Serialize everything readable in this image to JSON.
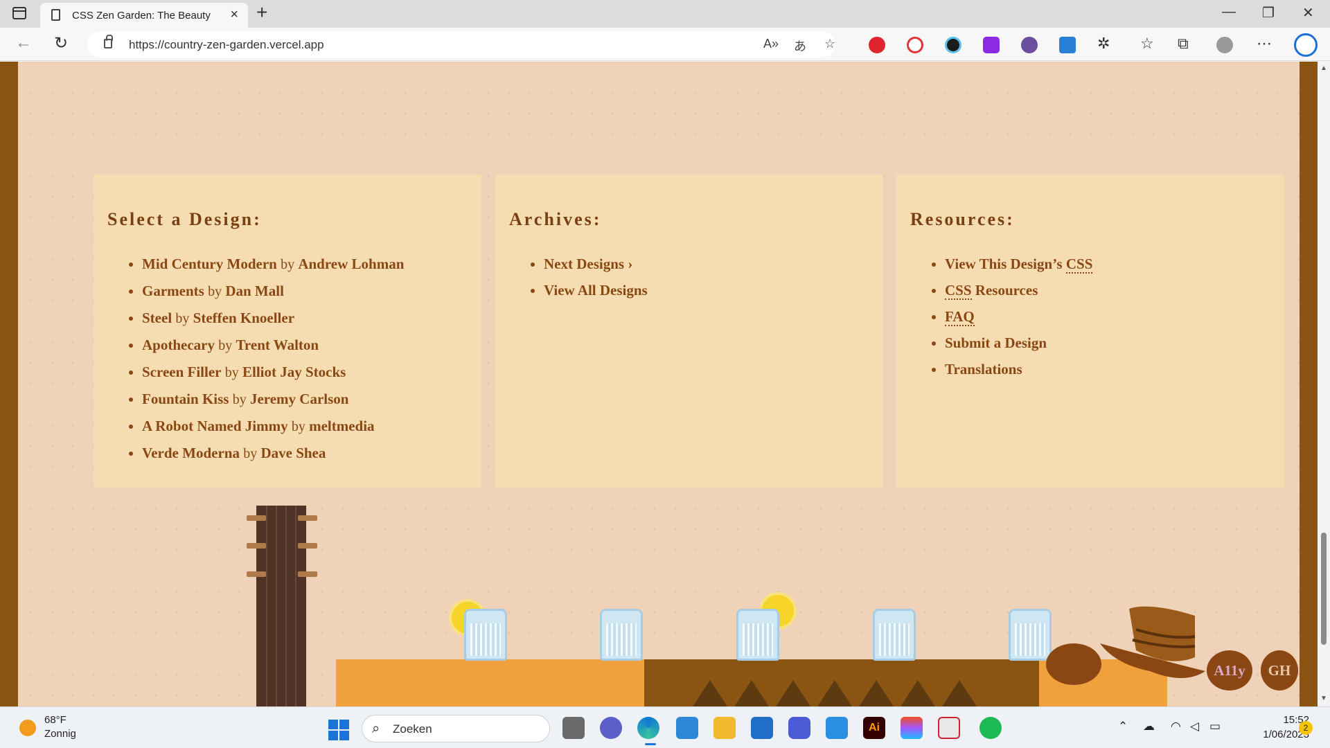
{
  "browser": {
    "tab_title": "CSS Zen Garden: The Beauty of CSS",
    "url": "https://country-zen-garden.vercel.app",
    "new_tab": "+",
    "close_tab": "×",
    "window_controls": [
      "—",
      "❐",
      "✕"
    ]
  },
  "page": {
    "panels": [
      {
        "heading": "Select a Design:",
        "items": [
          {
            "title": "Mid Century Modern",
            "by": "by",
            "author": "Andrew Lohman"
          },
          {
            "title": "Garments",
            "by": "by",
            "author": "Dan Mall"
          },
          {
            "title": "Steel",
            "by": "by",
            "author": "Steffen Knoeller"
          },
          {
            "title": "Apothecary",
            "by": "by",
            "author": "Trent Walton"
          },
          {
            "title": "Screen Filler",
            "by": "by",
            "author": "Elliot Jay Stocks"
          },
          {
            "title": "Fountain Kiss",
            "by": "by",
            "author": "Jeremy Carlson"
          },
          {
            "title": "A Robot Named Jimmy",
            "by": "by",
            "author": "meltmedia"
          },
          {
            "title": "Verde Moderna",
            "by": "by",
            "author": "Dave Shea"
          }
        ]
      },
      {
        "heading": "Archives:",
        "items": [
          "Next Designs ›",
          "View All Designs"
        ]
      },
      {
        "heading": "Resources:",
        "items": [
          "View This Design’s ",
          "Resources",
          "FAQ",
          "Submit a Design",
          "Translations"
        ],
        "abbr": "CSS"
      }
    ],
    "badges": [
      "A11y",
      "GH"
    ]
  },
  "taskbar": {
    "temperature": "68°F",
    "condition": "Zonnig",
    "search_placeholder": "Zoeken",
    "time": "15:52",
    "date": "1/06/2023",
    "notifications": "2"
  },
  "colors": {
    "page_bg": "#f0d2b8",
    "panel_bg": "#f5ddb1",
    "link": "#8a4714",
    "frame": "#8a5413"
  }
}
